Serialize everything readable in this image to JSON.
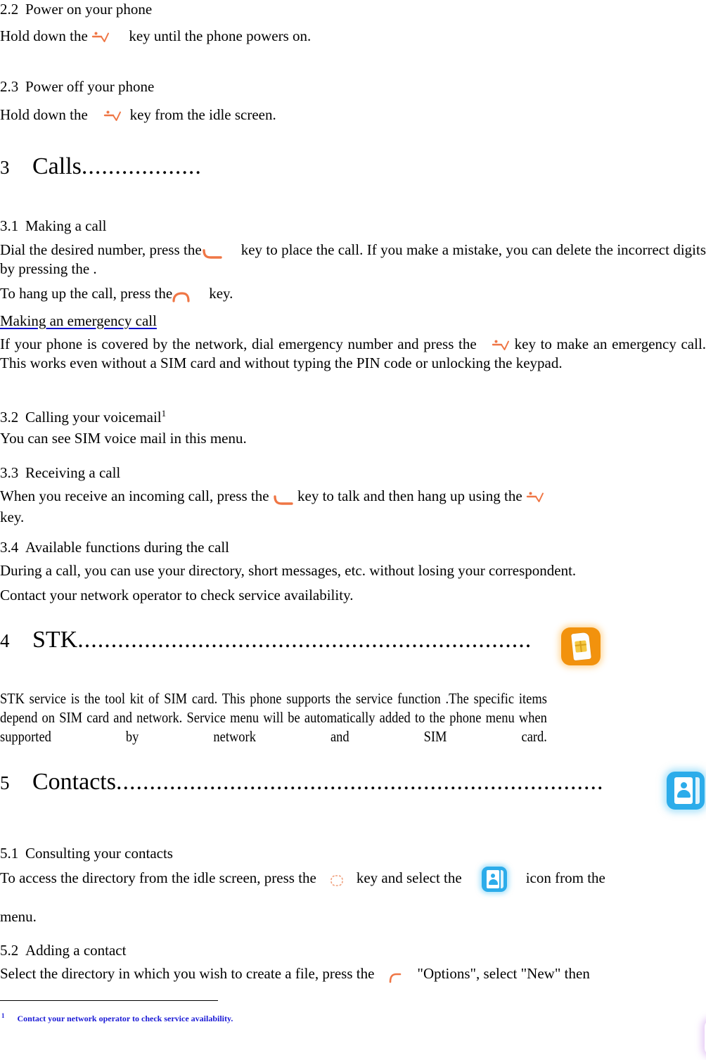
{
  "document": {
    "sections": {
      "s22_heading_num": "2.2",
      "s22_heading_text": "Power on your phone",
      "s22_body_before": "Hold down the",
      "s22_body_after": "key until the phone powers on.",
      "s23_heading_num": "2.3",
      "s23_heading_text": "Power off your phone",
      "s23_body_before": "Hold down the",
      "s23_body_after": "key from the idle screen.",
      "ch3_num": "3",
      "ch3_title": "Calls",
      "ch3_dots": "..................",
      "s31_heading_num": "3.1",
      "s31_heading_text": "Making a call",
      "s31_body_a": "Dial the desired number, press the",
      "s31_body_b": "key to place the call. If you make a mistake, you can delete the incorrect digits by pressing the .",
      "s31_body_c": "To hang up the call, press the",
      "s31_body_d": "key.",
      "s31_emergency_title": "Making an emergency call",
      "s31_emergency_a": "If your phone is covered by the network, dial emergency number and press the",
      "s31_emergency_b": "key to make an emergency call. This works even without a SIM card and without typing the PIN code or unlocking the keypad.",
      "s32_heading_num": "3.2",
      "s32_heading_text": "Calling your voicemail",
      "s32_heading_footnote": "1",
      "s32_body": "You can see SIM voice mail in this menu.",
      "s33_heading_num": "3.3",
      "s33_heading_text": "Receiving a call",
      "s33_body_a": "When you receive an incoming call, press the",
      "s33_body_b": "key to talk and then hang up using the",
      "s33_body_c": "key.",
      "s34_heading_num": "3.4",
      "s34_heading_text": "Available functions during the call",
      "s34_body_a": "During a call, you can use your directory, short messages, etc. without losing your correspondent.",
      "s34_body_b": "Contact your network operator to check service availability.",
      "ch4_num": "4",
      "ch4_title": "STK",
      "ch4_dots": "....................................................................",
      "ch4_body": "STK service is the tool kit of SIM card. This phone supports the service function .The specific items depend on SIM card and network. Service menu will be automatically added to the phone menu when supported by network and SIM card.",
      "ch5_num": "5",
      "ch5_title": "Contacts",
      "ch5_dots": ".........................................................................",
      "s51_heading_num": "5.1",
      "s51_heading_text": "Consulting your contacts",
      "s51_body_a": "To access the directory from the idle screen, press the",
      "s51_body_b": "key and select the",
      "s51_body_c": "icon from the",
      "s51_body_d": "menu.",
      "s52_heading_num": "5.2",
      "s52_heading_text": "Adding a contact",
      "s52_body_a": "Select the directory in which you wish to create a file, press the",
      "s52_body_b": "\"Options\", select \"New\" then"
    },
    "footnote": {
      "marker": "1",
      "text": "Contact your network operator to check service availability."
    },
    "icons": {
      "power_key": "power-key-icon",
      "send_key": "send-call-key-icon",
      "end_key": "end-call-key-icon",
      "ok_key": "ok-center-key-icon",
      "left_soft_key": "left-softkey-icon",
      "stk_app": "stk-sim-toolkit-icon",
      "contacts_app": "contacts-address-book-icon",
      "video_app": "video-player-icon"
    },
    "colors": {
      "key_orange": "#ef7645",
      "heading_underline_blue": "#1111cc",
      "footnote_blue": "#1a1ad6",
      "stk_icon_bg": "#f2920d",
      "contacts_icon_bg": "#2cacea",
      "video_icon_purple": "#5b1e86"
    }
  }
}
